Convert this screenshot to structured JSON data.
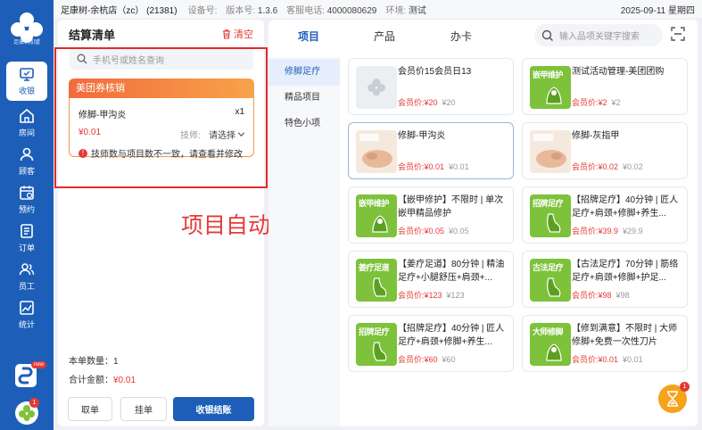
{
  "topbar": {
    "store": "足康树-余杭店（zc） (21381)",
    "device_label": "设备号:",
    "device_value": "",
    "version_label": "版本号:",
    "version_value": "1.3.6",
    "phone_label": "客服电话:",
    "phone_value": "4000080629",
    "env_label": "环境:",
    "env_value": "测试",
    "date": "2025-09-11 星期四"
  },
  "sidebar": {
    "logo_text": "足康树加盟",
    "items": [
      {
        "label": "收银",
        "icon": "cashier-icon"
      },
      {
        "label": "房间",
        "icon": "home-icon"
      },
      {
        "label": "顾客",
        "icon": "customer-icon"
      },
      {
        "label": "预约",
        "icon": "calendar-icon"
      },
      {
        "label": "订单",
        "icon": "order-icon"
      },
      {
        "label": "员工",
        "icon": "staff-icon"
      },
      {
        "label": "统计",
        "icon": "chart-icon"
      }
    ],
    "new_badge": "new",
    "notice_count": "1"
  },
  "settle": {
    "title": "结算清单",
    "clear": "清空",
    "search_placeholder": "手机号或姓名查询",
    "coupon_title": "美团券核销",
    "item_name": "修脚-甲沟炎",
    "item_qty": "x1",
    "item_price": "¥0.01",
    "tech_label": "技师:",
    "tech_select": "请选择",
    "warning": "技师数与项目数不一致，请查看并修改",
    "count_label": "本单数量：",
    "count_value": "1",
    "total_label": "合计金额：",
    "total_value": "¥0.01",
    "btn_take": "取单",
    "btn_hold": "挂单",
    "btn_pay": "收银结账"
  },
  "annotation": "项目自动添加",
  "catalog": {
    "tabs": [
      "项目",
      "产品",
      "办卡"
    ],
    "search_placeholder": "输入品项关键字搜索",
    "categories": [
      "修脚足疗",
      "精品项目",
      "特色小项"
    ],
    "member_label": "会员价:",
    "items": [
      {
        "name": "会员价15会员日13",
        "member_price": "¥20",
        "price": "¥20",
        "thumb": "placeholder",
        "title": "",
        "sub": ""
      },
      {
        "name": "测试活动管理-美团团购",
        "member_price": "¥2",
        "price": "¥2",
        "thumb": "green",
        "title": "嵌甲维护",
        "sub": ""
      },
      {
        "name": "修脚-甲沟炎",
        "member_price": "¥0.01",
        "price": "¥0.01",
        "thumb": "photo",
        "title": "",
        "sub": ""
      },
      {
        "name": "修脚-灰指甲",
        "member_price": "¥0.02",
        "price": "¥0.02",
        "thumb": "photo",
        "title": "",
        "sub": ""
      },
      {
        "name": "【嵌甲修护】不限时 | 单次嵌甲精品修护",
        "member_price": "¥0.05",
        "price": "¥0.05",
        "thumb": "green",
        "title": "嵌甲维护",
        "sub": ""
      },
      {
        "name": "【招牌足疗】40分钟 | 匠人足疗+肩颈+修脚+养生...",
        "member_price": "¥39.9",
        "price": "¥29.9",
        "thumb": "green",
        "title": "招牌足疗",
        "sub": ""
      },
      {
        "name": "【姜疗足道】80分钟 | 精油足疗+小腿舒压+肩颈+...",
        "member_price": "¥123",
        "price": "¥123",
        "thumb": "green",
        "title": "姜疗足道",
        "sub": ""
      },
      {
        "name": "【古法足疗】70分钟 | 筋络足疗+肩颈+修脚+护足...",
        "member_price": "¥98",
        "price": "¥98",
        "thumb": "green",
        "title": "古法足疗",
        "sub": ""
      },
      {
        "name": "【招牌足疗】40分钟 | 匠人足疗+肩颈+修脚+养生...",
        "member_price": "¥60",
        "price": "¥60",
        "thumb": "green",
        "title": "招牌足疗",
        "sub": ""
      },
      {
        "name": "【修到满意】不限时 | 大师修脚+免费一次性刀片",
        "member_price": "¥0.01",
        "price": "¥0.01",
        "thumb": "green",
        "title": "大师修脚",
        "sub": ""
      }
    ]
  },
  "float_badge": "1",
  "colors": {
    "brand": "#1d5fb8",
    "accent_red": "#e53935",
    "coupon_orange": "#f26a3c",
    "thumb_green": "#7dc23a"
  }
}
